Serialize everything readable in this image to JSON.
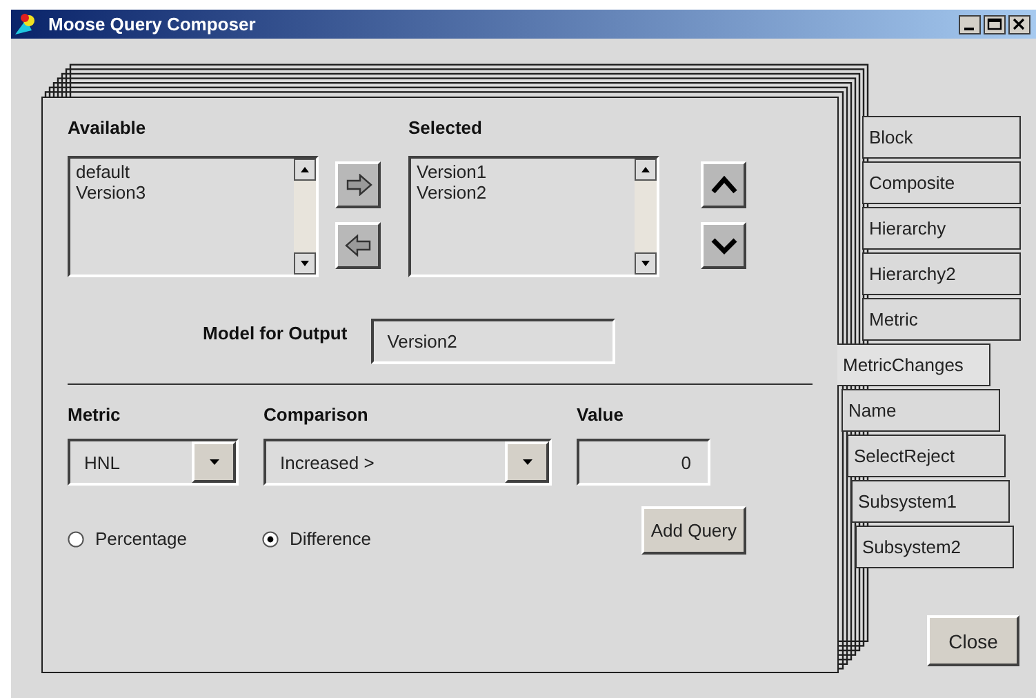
{
  "window": {
    "title": "Moose Query Composer"
  },
  "available": {
    "label": "Available",
    "items": [
      "default",
      "Version3"
    ]
  },
  "selected": {
    "label": "Selected",
    "items": [
      "Version1",
      "Version2"
    ]
  },
  "output_model": {
    "label": "Model for Output",
    "value": "Version2"
  },
  "metric": {
    "label": "Metric",
    "value": "HNL"
  },
  "comparison": {
    "label": "Comparison",
    "value": "Increased >"
  },
  "value": {
    "label": "Value",
    "value": "0"
  },
  "mode_options": [
    {
      "label": "Percentage",
      "selected": false
    },
    {
      "label": "Difference",
      "selected": true
    }
  ],
  "add_button": "Add Query",
  "tabs": [
    {
      "label": "Block",
      "selected": false
    },
    {
      "label": "Composite",
      "selected": false
    },
    {
      "label": "Hierarchy",
      "selected": false
    },
    {
      "label": "Hierarchy2",
      "selected": false
    },
    {
      "label": "Metric",
      "selected": false
    },
    {
      "label": "MetricChanges",
      "selected": true
    },
    {
      "label": "Name",
      "selected": false
    },
    {
      "label": "SelectReject",
      "selected": false
    },
    {
      "label": "Subsystem1",
      "selected": false
    },
    {
      "label": "Subsystem2",
      "selected": false
    }
  ],
  "close_button": "Close"
}
